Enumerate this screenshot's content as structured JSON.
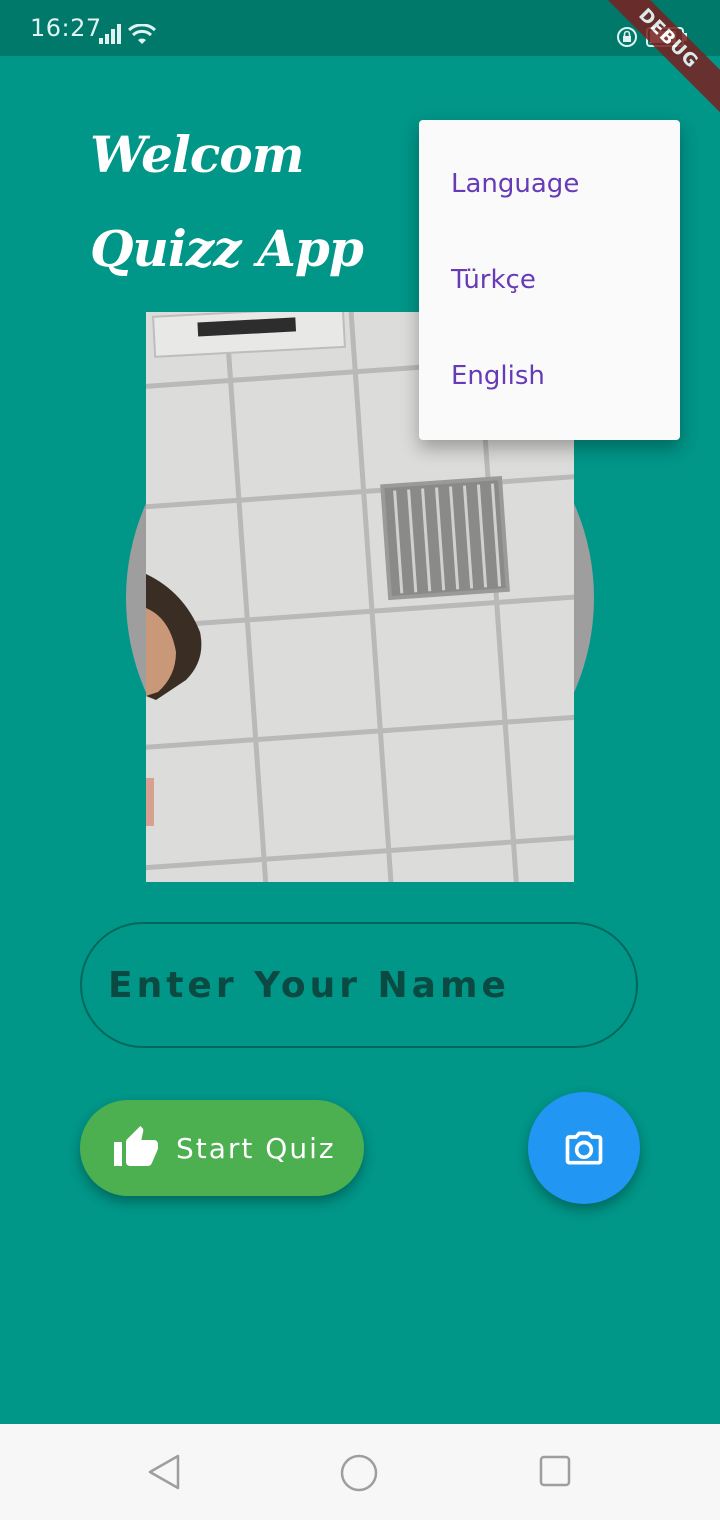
{
  "status_bar": {
    "time": "16:27",
    "debug_label": "DEBUG",
    "icons": [
      "signal-icon",
      "wifi-icon",
      "rotate-lock-icon",
      "battery-icon"
    ]
  },
  "main": {
    "title": "Welcom Quizz App",
    "name_input": {
      "placeholder": "Enter Your Name",
      "value": ""
    },
    "start_button_label": "Start Quiz",
    "start_icon": "thumb-up-icon",
    "camera_icon": "camera-icon"
  },
  "language_menu": {
    "items": [
      {
        "label": "Language"
      },
      {
        "label": "Türkçe"
      },
      {
        "label": "English"
      }
    ]
  },
  "nav_bar": {
    "icons": [
      "back-icon",
      "home-icon",
      "recents-icon"
    ]
  },
  "colors": {
    "background": "#009688",
    "status_bar": "#00796b",
    "start_button": "#4caf50",
    "camera_button": "#2196f3",
    "menu_text": "#673ab7"
  }
}
